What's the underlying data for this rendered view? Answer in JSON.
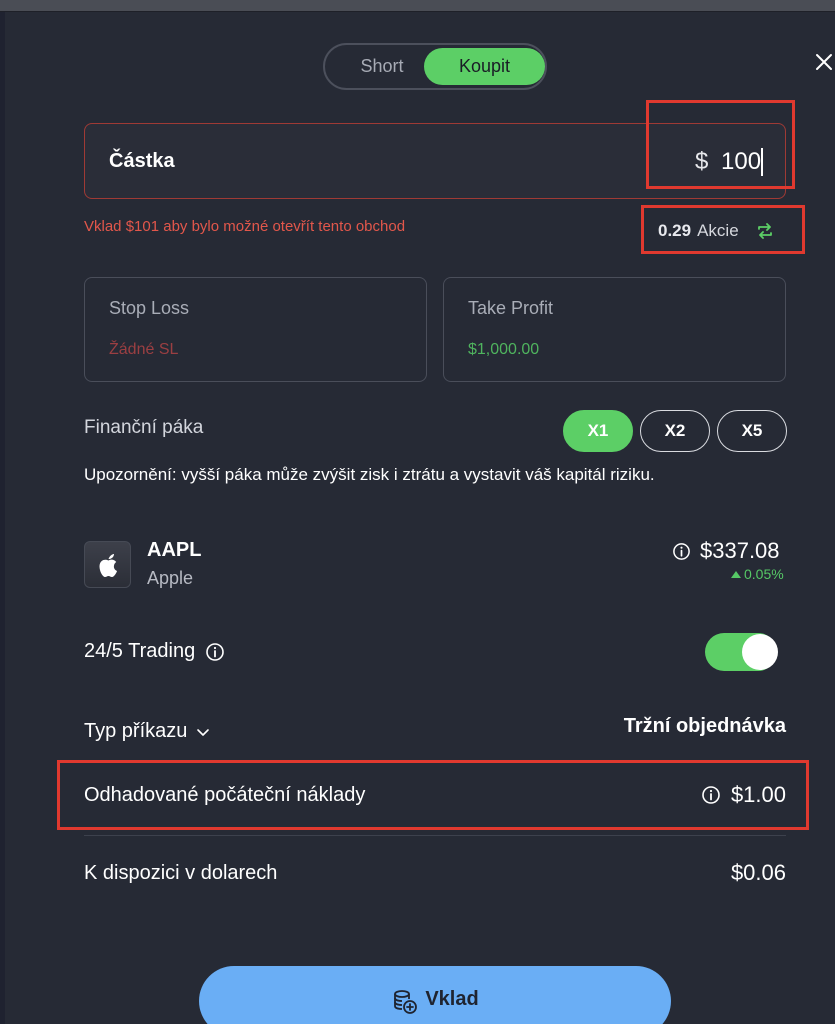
{
  "side_toggle": {
    "short_label": "Short",
    "buy_label": "Koupit",
    "selected": "Koupit"
  },
  "close_icon": "close-icon",
  "amount": {
    "label": "Částka",
    "currency": "$",
    "value": "100"
  },
  "warning": "Vklad $101 aby bylo možné otevřít tento obchod",
  "shares": {
    "value": "0.29",
    "unit": "Akcie",
    "icon": "swap-icon"
  },
  "stop_loss": {
    "title": "Stop Loss",
    "value": "Žádné SL"
  },
  "take_profit": {
    "title": "Take Profit",
    "value": "$1,000.00"
  },
  "leverage": {
    "label": "Finanční páka",
    "options": [
      "X1",
      "X2",
      "X5"
    ],
    "selected": "X1"
  },
  "notice": "Upozornění: vyšší páka může zvýšit zisk i ztrátu a vystavit váš kapitál riziku.",
  "instrument": {
    "ticker": "AAPL",
    "name": "Apple",
    "price": "$337.08",
    "change": "0.05%",
    "logo_icon": "apple-logo-icon"
  },
  "trading": {
    "label": "24/5 Trading",
    "enabled": true
  },
  "order_type": {
    "label": "Typ příkazu",
    "value": "Tržní objednávka"
  },
  "estimated_cost": {
    "label": "Odhadované počáteční náklady",
    "value": "$1.00"
  },
  "available": {
    "label": "K dispozici v dolarech",
    "value": "$0.06"
  },
  "deposit_button": {
    "label": "Vklad",
    "icon": "coins-plus-icon"
  },
  "colors": {
    "accent_green": "#5ccf66",
    "background": "#262a35",
    "error_red": "#e2574b",
    "highlight_red": "#e0392f",
    "deposit_blue": "#6aaef5"
  }
}
